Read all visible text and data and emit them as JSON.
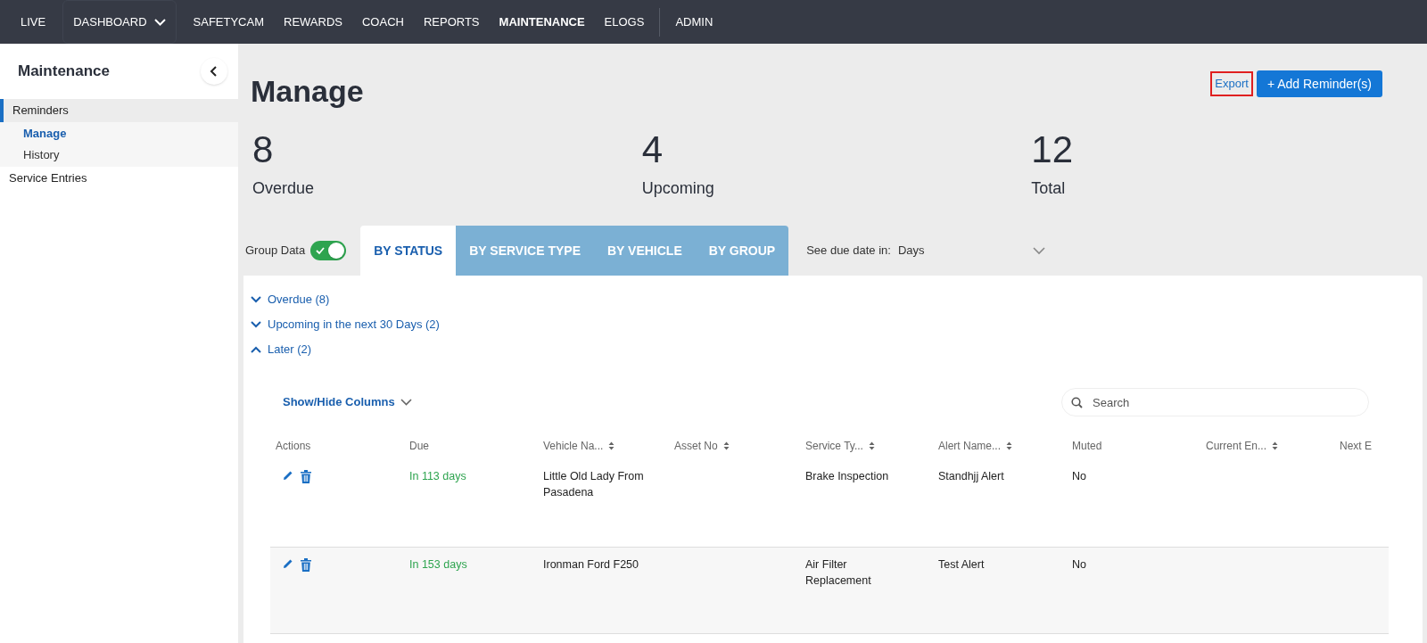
{
  "nav": [
    {
      "label": "LIVE",
      "selected": false,
      "dropdown": false
    },
    {
      "label": "DASHBOARD",
      "selected": false,
      "dropdown": true
    },
    {
      "label": "SAFETYCAM",
      "selected": false,
      "dropdown": false
    },
    {
      "label": "REWARDS",
      "selected": false,
      "dropdown": false
    },
    {
      "label": "COACH",
      "selected": false,
      "dropdown": false
    },
    {
      "label": "REPORTS",
      "selected": false,
      "dropdown": false
    },
    {
      "label": "MAINTENANCE",
      "selected": true,
      "dropdown": false
    },
    {
      "label": "ELOGS",
      "selected": false,
      "dropdown": false
    },
    {
      "label": "ADMIN",
      "selected": false,
      "dropdown": false
    }
  ],
  "sidebar": {
    "title": "Maintenance",
    "items": [
      {
        "label": "Reminders",
        "selected": true,
        "children": [
          {
            "label": "Manage",
            "selected": true
          },
          {
            "label": "History",
            "selected": false
          }
        ]
      },
      {
        "label": "Service Entries",
        "selected": false
      }
    ]
  },
  "page": {
    "title": "Manage",
    "export": "Export",
    "add_button": "+ Add Reminder(s)"
  },
  "stats": [
    {
      "value": "8",
      "label": "Overdue"
    },
    {
      "value": "4",
      "label": "Upcoming"
    },
    {
      "value": "12",
      "label": "Total"
    }
  ],
  "group_data": {
    "label": "Group Data",
    "on": true
  },
  "tabs": [
    {
      "label": "BY STATUS",
      "selected": true
    },
    {
      "label": "BY SERVICE TYPE",
      "selected": false
    },
    {
      "label": "BY VEHICLE",
      "selected": false
    },
    {
      "label": "BY GROUP",
      "selected": false
    }
  ],
  "due_date": {
    "label": "See due date in:",
    "value": "Days"
  },
  "groups": [
    {
      "label": "Overdue (8)",
      "expanded": false
    },
    {
      "label": "Upcoming in the next 30 Days (2)",
      "expanded": false
    },
    {
      "label": "Later (2)",
      "expanded": true
    }
  ],
  "table": {
    "show_hide": "Show/Hide Columns",
    "search": {
      "placeholder": "Search"
    },
    "columns": [
      {
        "label": "Actions",
        "sortable": false
      },
      {
        "label": "Due",
        "sortable": false
      },
      {
        "label": "Vehicle Na...",
        "sortable": true
      },
      {
        "label": "Asset No",
        "sortable": true
      },
      {
        "label": "Service Ty...",
        "sortable": true
      },
      {
        "label": "Alert Name...",
        "sortable": true
      },
      {
        "label": "Muted",
        "sortable": false
      },
      {
        "label": "Current En...",
        "sortable": true
      },
      {
        "label": "Next E"
      }
    ],
    "rows": [
      {
        "highlighted": false,
        "cells": [
          "",
          "In 113 days",
          "Little Old Lady From Pasadena",
          "",
          "Brake Inspection",
          "Standhjj Alert",
          "No",
          "",
          ""
        ]
      },
      {
        "highlighted": true,
        "cells": [
          "",
          "In 153 days",
          "Ironman Ford F250",
          "",
          "Air Filter Replacement",
          "Test Alert",
          "No",
          "",
          ""
        ]
      }
    ]
  }
}
